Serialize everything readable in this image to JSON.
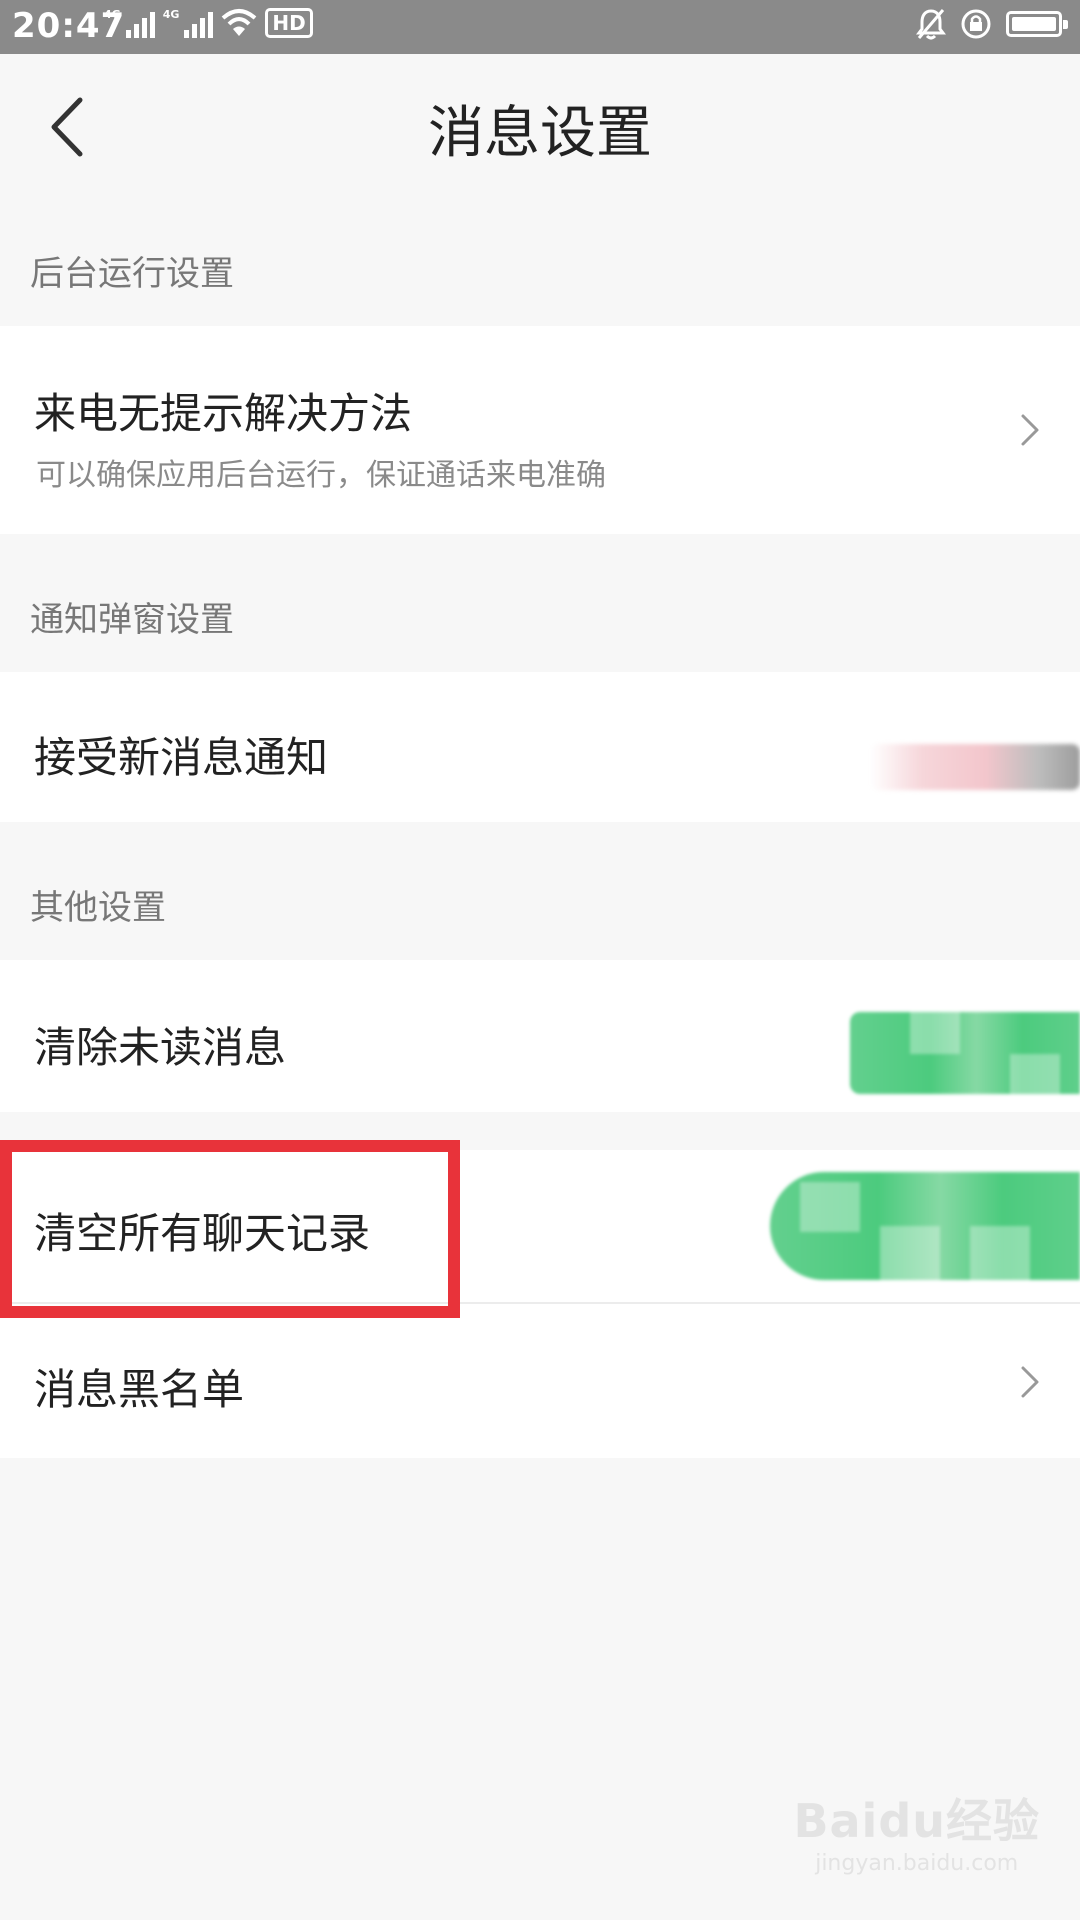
{
  "status_bar": {
    "time": "20:47",
    "network_1": "4G",
    "network_2": "4G",
    "hd_label": "HD",
    "icons": [
      "signal-icon",
      "signal-icon",
      "wifi-icon",
      "hd-icon",
      "bell-off-icon",
      "rotation-lock-icon",
      "battery-icon"
    ]
  },
  "header": {
    "title": "消息设置",
    "back_icon": "chevron-left-icon"
  },
  "sections": [
    {
      "label": "后台运行设置",
      "items": [
        {
          "title": "来电无提示解决方法",
          "subtitle": "可以确保应用后台运行，保证通话来电准确",
          "icon": "chevron-right-icon"
        }
      ]
    },
    {
      "label": "通知弹窗设置",
      "items": [
        {
          "title": "接受新消息通知"
        }
      ]
    },
    {
      "label": "其他设置",
      "items": [
        {
          "title": "清除未读消息"
        },
        {
          "title": "清空所有聊天记录",
          "highlighted": true
        },
        {
          "title": "消息黑名单",
          "icon": "chevron-right-icon"
        }
      ]
    }
  ],
  "watermark": {
    "brand": "Baidu经验",
    "url": "jingyan.baidu.com"
  },
  "colors": {
    "highlight_frame": "#e8333a",
    "status_bar_bg": "#8a8a8a",
    "page_bg": "#f7f7f7",
    "blur_green": "#4ccb7e"
  }
}
